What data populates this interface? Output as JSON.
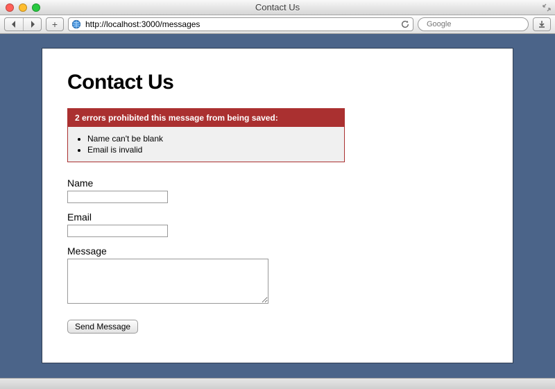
{
  "window": {
    "title": "Contact Us"
  },
  "toolbar": {
    "url": "http://localhost:3000/messages",
    "search_placeholder": "Google",
    "add_label": "+"
  },
  "page": {
    "heading": "Contact Us",
    "error": {
      "heading": "2 errors prohibited this message from being saved:",
      "items": [
        "Name can't be blank",
        "Email is invalid"
      ]
    },
    "fields": {
      "name_label": "Name",
      "name_value": "",
      "email_label": "Email",
      "email_value": "",
      "message_label": "Message",
      "message_value": ""
    },
    "submit_label": "Send Message"
  }
}
